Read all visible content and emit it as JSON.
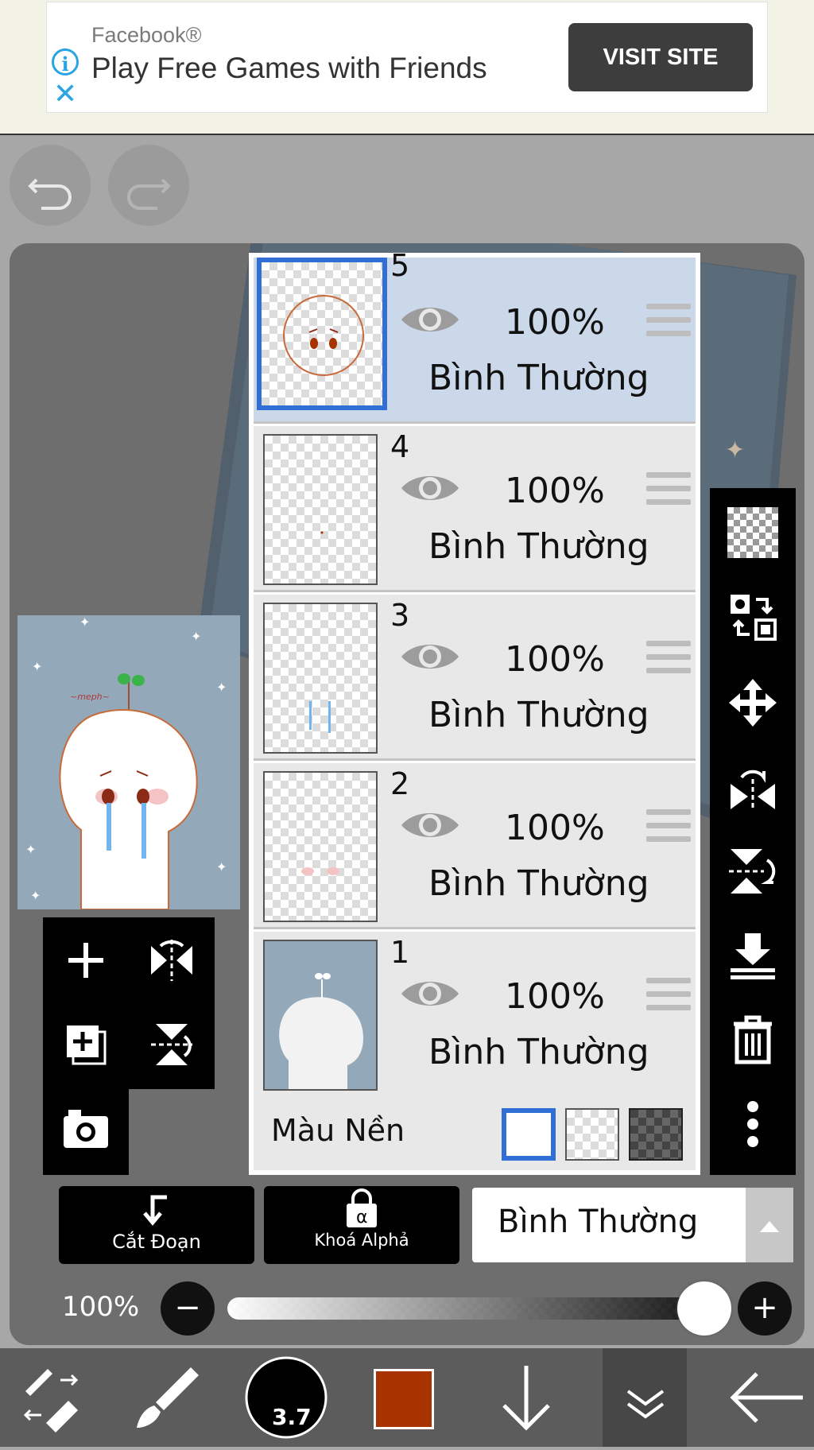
{
  "ad": {
    "source": "Facebook®",
    "headline": "Play Free Games with Friends",
    "cta": "VISIT SITE"
  },
  "layers": [
    {
      "number": "5",
      "opacity": "100%",
      "blend": "Bình Thường",
      "selected": true
    },
    {
      "number": "4",
      "opacity": "100%",
      "blend": "Bình Thường",
      "selected": false
    },
    {
      "number": "3",
      "opacity": "100%",
      "blend": "Bình Thường",
      "selected": false
    },
    {
      "number": "2",
      "opacity": "100%",
      "blend": "Bình Thường",
      "selected": false
    },
    {
      "number": "1",
      "opacity": "100%",
      "blend": "Bình Thường",
      "selected": false
    }
  ],
  "background": {
    "label": "Màu Nền",
    "selected": "white"
  },
  "actions": {
    "clip": "Cắt Đoạn",
    "alpha_lock": "Khoá Alphả",
    "blend_mode": "Bình Thường"
  },
  "opacity": {
    "value": "100%",
    "level": 1.0
  },
  "brush": {
    "size": "3.7"
  },
  "colors": {
    "current": "#a83300",
    "accent": "#2f6fd6",
    "selection": "#cbd8ea"
  }
}
